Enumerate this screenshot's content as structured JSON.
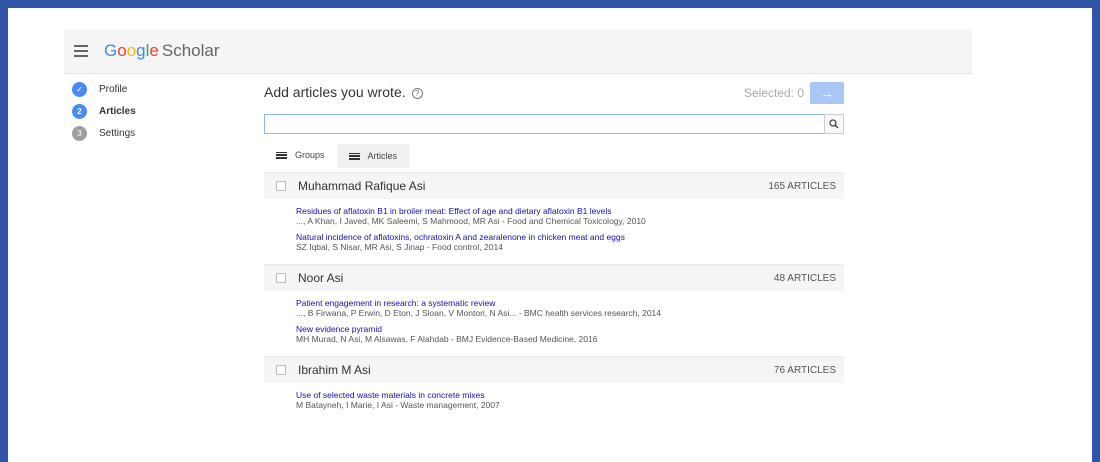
{
  "app": {
    "logo_google": [
      "G",
      "o",
      "o",
      "g",
      "l",
      "e"
    ],
    "logo_scholar": "Scholar"
  },
  "steps": [
    {
      "num": "✓",
      "label": "Profile"
    },
    {
      "num": "2",
      "label": "Articles"
    },
    {
      "num": "3",
      "label": "Settings"
    }
  ],
  "header": {
    "title": "Add articles you wrote.",
    "help_glyph": "?",
    "selected_text": "Selected: 0",
    "next_glyph": "→"
  },
  "search": {
    "value": "",
    "placeholder": ""
  },
  "tabs": [
    {
      "label": "Groups"
    },
    {
      "label": "Articles"
    }
  ],
  "groups": [
    {
      "name": "Muhammad Rafique Asi",
      "count": "165 ARTICLES",
      "articles": [
        {
          "title": "Residues of aflatoxin B1 in broiler meat: Effect of age and dietary aflatoxin B1 levels",
          "meta": "..., A Khan, I Javed, MK Saleemi, S Mahmood, MR Asi - Food and Chemical Toxicology, 2010"
        },
        {
          "title": "Natural incidence of aflatoxins, ochratoxin A and zearalenone in chicken meat and eggs",
          "meta": "SZ Iqbal, S Nisar, MR Asi, S Jinap - Food control, 2014"
        }
      ]
    },
    {
      "name": "Noor Asi",
      "count": "48 ARTICLES",
      "articles": [
        {
          "title": "Patient engagement in research: a systematic review",
          "meta": "..., B Firwana, P Erwin, D Eton, J Sloan, V Montori, N Asi... - BMC health services research, 2014"
        },
        {
          "title": "New evidence pyramid",
          "meta": "MH Murad, N Asi, M Alsawas, F Alahdab - BMJ Evidence-Based Medicine, 2016"
        }
      ]
    },
    {
      "name": "Ibrahim M Asi",
      "count": "76 ARTICLES",
      "articles": [
        {
          "title": "Use of selected waste materials in concrete mixes",
          "meta": "M Batayneh, I Marie, I Asi - Waste management, 2007"
        }
      ]
    }
  ]
}
